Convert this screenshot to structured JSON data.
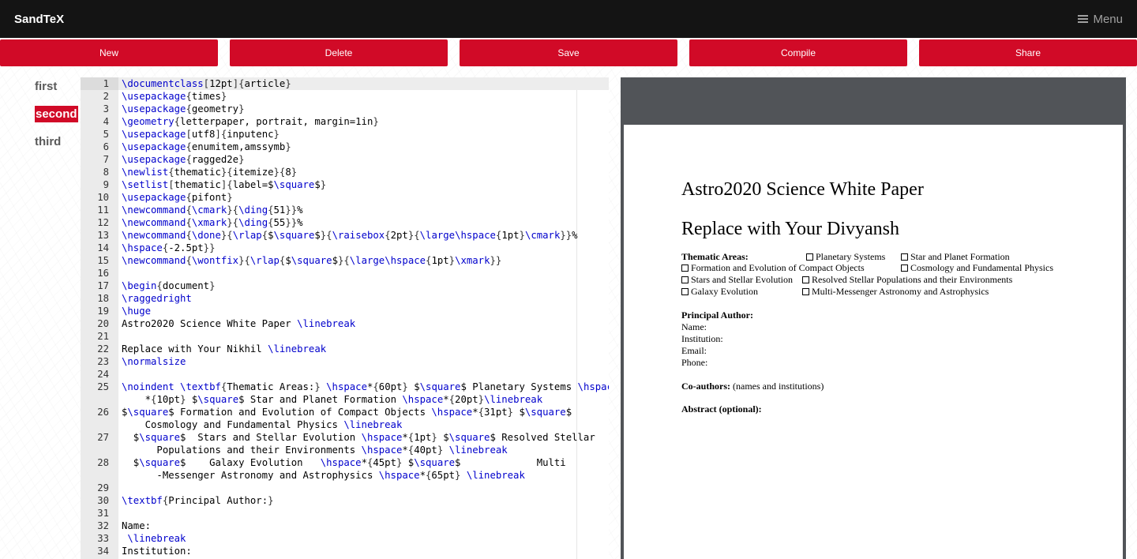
{
  "app": {
    "brand": "SandTeX",
    "menu_label": "Menu"
  },
  "toolbar": {
    "buttons": [
      "New",
      "Delete",
      "Save",
      "Compile",
      "Share"
    ],
    "accent_color": "#d10a27"
  },
  "documents": {
    "items": [
      "first",
      "second",
      "third"
    ],
    "active": "second"
  },
  "editor": {
    "lines": [
      {
        "n": "1",
        "text": "\\documentclass[12pt]{article}"
      },
      {
        "n": "2",
        "text": "\\usepackage{times}"
      },
      {
        "n": "3",
        "text": "\\usepackage{geometry}"
      },
      {
        "n": "4",
        "text": "\\geometry{letterpaper, portrait, margin=1in}"
      },
      {
        "n": "5",
        "text": "\\usepackage[utf8]{inputenc}"
      },
      {
        "n": "6",
        "text": "\\usepackage{enumitem,amssymb}"
      },
      {
        "n": "7",
        "text": "\\usepackage{ragged2e}"
      },
      {
        "n": "8",
        "text": "\\newlist{thematic}{itemize}{8}"
      },
      {
        "n": "9",
        "text": "\\setlist[thematic]{label=$\\square$}"
      },
      {
        "n": "10",
        "text": "\\usepackage{pifont}"
      },
      {
        "n": "11",
        "text": "\\newcommand{\\cmark}{\\ding{51}}%"
      },
      {
        "n": "12",
        "text": "\\newcommand{\\xmark}{\\ding{55}}%"
      },
      {
        "n": "13",
        "text": "\\newcommand{\\done}{\\rlap{$\\square$}{\\raisebox{2pt}{\\large\\hspace{1pt}\\cmark}}%"
      },
      {
        "n": "14",
        "text": "\\hspace{-2.5pt}}"
      },
      {
        "n": "15",
        "text": "\\newcommand{\\wontfix}{\\rlap{$\\square$}{\\large\\hspace{1pt}\\xmark}}"
      },
      {
        "n": "16",
        "text": ""
      },
      {
        "n": "17",
        "text": "\\begin{document}"
      },
      {
        "n": "18",
        "text": "\\raggedright"
      },
      {
        "n": "19",
        "text": "\\huge"
      },
      {
        "n": "20",
        "text": "Astro2020 Science White Paper \\linebreak"
      },
      {
        "n": "21",
        "text": ""
      },
      {
        "n": "22",
        "text": "Replace with Your Nikhil \\linebreak"
      },
      {
        "n": "23",
        "text": "\\normalsize"
      },
      {
        "n": "24",
        "text": ""
      },
      {
        "n": "25",
        "text": "\\noindent \\textbf{Thematic Areas:} \\hspace*{60pt} $\\square$ Planetary Systems \\hspace",
        "cont": "*{10pt} $\\square$ Star and Planet Formation \\hspace*{20pt}\\linebreak"
      },
      {
        "n": "26",
        "text": "$\\square$ Formation and Evolution of Compact Objects \\hspace*{31pt} $\\square$",
        "cont": "Cosmology and Fundamental Physics \\linebreak"
      },
      {
        "n": "27",
        "text": "  $\\square$  Stars and Stellar Evolution \\hspace*{1pt} $\\square$ Resolved Stellar",
        "cont": "  Populations and their Environments \\hspace*{40pt} \\linebreak"
      },
      {
        "n": "28",
        "text": "  $\\square$    Galaxy Evolution   \\hspace*{45pt} $\\square$             Multi",
        "cont": "  -Messenger Astronomy and Astrophysics \\hspace*{65pt} \\linebreak"
      },
      {
        "n": "29",
        "text": ""
      },
      {
        "n": "30",
        "text": "\\textbf{Principal Author:}"
      },
      {
        "n": "31",
        "text": ""
      },
      {
        "n": "32",
        "text": "Name:"
      },
      {
        "n": "33",
        "text": " \\linebreak"
      },
      {
        "n": "34",
        "text": "Institution:"
      }
    ]
  },
  "preview": {
    "title": "Astro2020 Science White Paper",
    "subtitle": "Replace with Your Divyansh",
    "thematic_label": "Thematic Areas:",
    "areas": [
      "Planetary Systems",
      "Star and Planet Formation",
      "Formation and Evolution of Compact Objects",
      "Cosmology and Fundamental Physics",
      "Stars and Stellar Evolution",
      "Resolved Stellar Populations and their Environments",
      "Galaxy Evolution",
      "Multi-Messenger Astronomy and Astrophysics"
    ],
    "principal_author": "Principal Author:",
    "fields": [
      "Name:",
      "Institution:",
      "Email:",
      "Phone:"
    ],
    "coauthors_label": "Co-authors:",
    "coauthors_text": "(names and institutions)",
    "abstract_label": "Abstract (optional):"
  }
}
